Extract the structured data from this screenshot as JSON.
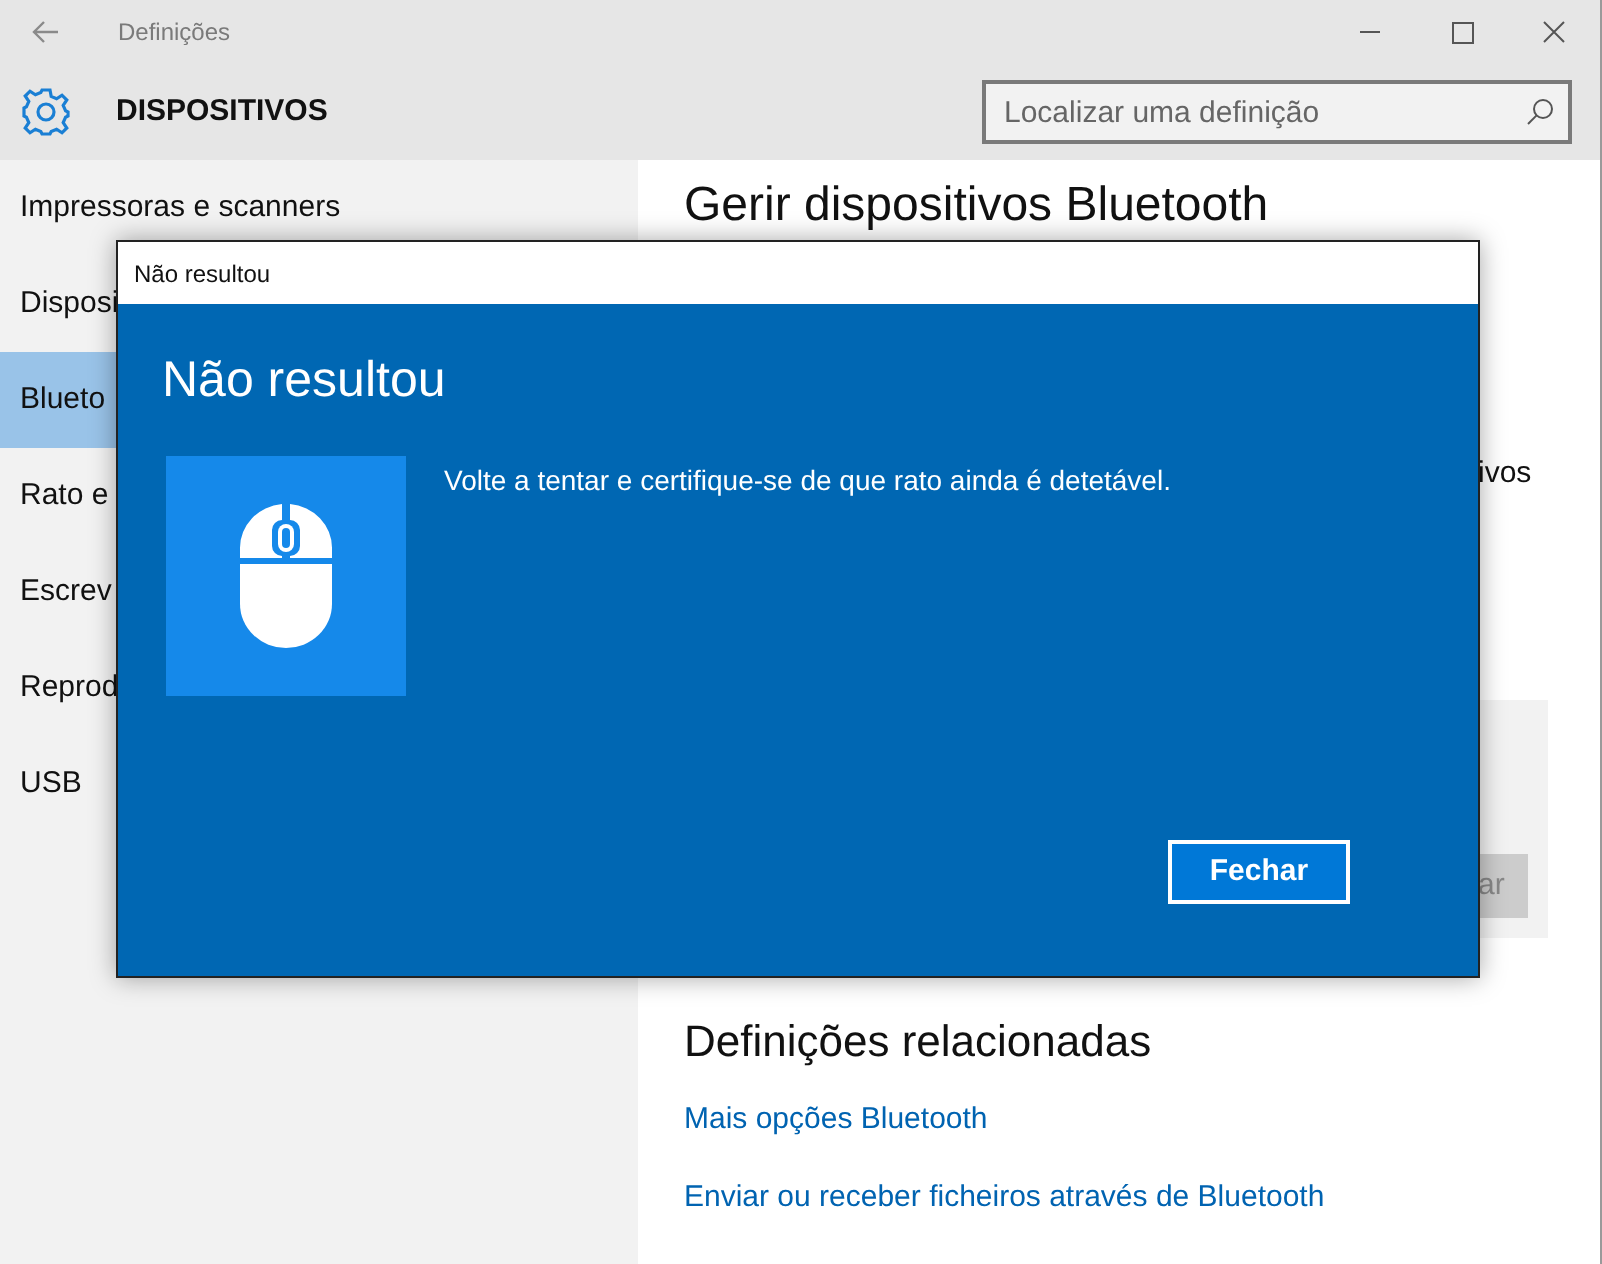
{
  "window": {
    "title": "Definições"
  },
  "header": {
    "title": "DISPOSITIVOS",
    "search": {
      "placeholder": "Localizar uma definição"
    }
  },
  "sidebar": {
    "items": [
      {
        "label": "Impressoras e scanners",
        "selected": false
      },
      {
        "label": "Disposi",
        "selected": false
      },
      {
        "label": "Blueto",
        "selected": true
      },
      {
        "label": "Rato e",
        "selected": false
      },
      {
        "label": "Escrev",
        "selected": false
      },
      {
        "label": "Reprod",
        "selected": false
      },
      {
        "label": "USB",
        "selected": false
      }
    ]
  },
  "content": {
    "heading": "Gerir dispositivos Bluetooth",
    "fragment": "ivos",
    "button_fragment": "ar",
    "related_heading": "Definições relacionadas",
    "links": [
      "Mais opções Bluetooth",
      "Enviar ou receber ficheiros através de Bluetooth"
    ]
  },
  "dialog": {
    "title": "Não resultou",
    "heading": "Não resultou",
    "message": "Volte a tentar e certifique-se de que rato ainda é detetável.",
    "button": "Fechar"
  }
}
